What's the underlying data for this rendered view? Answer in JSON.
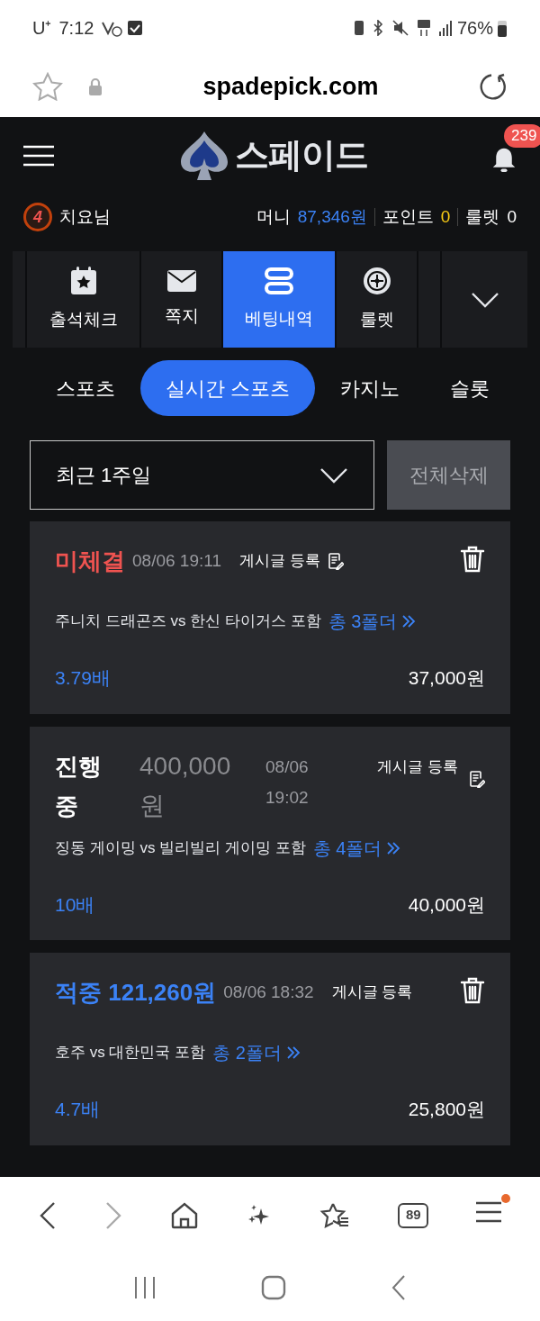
{
  "status_bar": {
    "carrier": "U⁺",
    "time": "7:12",
    "battery": "76%"
  },
  "address_bar": {
    "url": "spadepick.com"
  },
  "header": {
    "logo": "스페이드",
    "notification_count": "239"
  },
  "user": {
    "level": "4",
    "name": "치요님",
    "money_label": "머니",
    "money": "87,346원",
    "point_label": "포인트",
    "point": "0",
    "roulette_label": "룰렛",
    "roulette": "0"
  },
  "menu": [
    {
      "label": "출석체크",
      "selected": false
    },
    {
      "label": "쪽지",
      "selected": false
    },
    {
      "label": "베팅내역",
      "selected": true
    },
    {
      "label": "룰렛",
      "selected": false
    }
  ],
  "sub_tabs": [
    {
      "label": "스포츠",
      "selected": false
    },
    {
      "label": "실시간 스포츠",
      "selected": true
    },
    {
      "label": "카지노",
      "selected": false
    },
    {
      "label": "슬롯",
      "selected": false
    }
  ],
  "filter": {
    "value": "최근 1주일",
    "delete_all": "전체삭제"
  },
  "bets": [
    {
      "kind": "pending",
      "status": "미체결",
      "date": "08/06 19:11",
      "post_label": "게시글 등록",
      "deletable": true,
      "match": "주니치 드래곤즈 vs 한신 타이거스 포함",
      "folders": "총 3폴더",
      "odds": "3.79배",
      "stake": "37,000원"
    },
    {
      "kind": "in_progress",
      "status": "진행중",
      "amount": "400,000원",
      "date": "08/06 19:02",
      "post_label": "게시글 등록",
      "deletable": false,
      "match": "징동 게이밍 vs 빌리빌리 게이밍 포함",
      "folders": "총 4폴더",
      "odds": "10배",
      "stake": "40,000원"
    },
    {
      "kind": "won",
      "status": "적중",
      "amount": "121,260원",
      "date": "08/06 18:32",
      "post_label": "게시글 등록",
      "deletable": true,
      "match": "호주 vs 대한민국 포함",
      "folders": "총 2폴더",
      "odds": "4.7배",
      "stake": "25,800원"
    }
  ],
  "browser_nav": {
    "forward_disabled": true,
    "tab_count": "89",
    "menu_badge": true
  }
}
